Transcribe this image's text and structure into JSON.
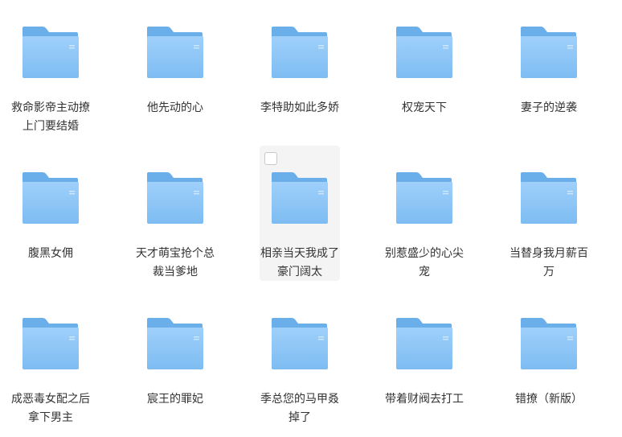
{
  "folders": [
    {
      "name": "救命影帝主动撩上门要结婚"
    },
    {
      "name": "他先动的心"
    },
    {
      "name": "李特助如此多娇"
    },
    {
      "name": "权宠天下"
    },
    {
      "name": "妻子的逆袭"
    },
    {
      "name": "腹黑女佣"
    },
    {
      "name": "天才萌宝抢个总裁当爹地"
    },
    {
      "name": "相亲当天我成了豪门阔太"
    },
    {
      "name": "别惹盛少的心尖宠"
    },
    {
      "name": "当替身我月薪百万"
    },
    {
      "name": "成恶毒女配之后拿下男主"
    },
    {
      "name": "宸王的罪妃"
    },
    {
      "name": "季总您的马甲叒掉了"
    },
    {
      "name": "带着财阀去打工"
    },
    {
      "name": "错撩（新版）"
    }
  ],
  "colors": {
    "folder_back": "#6aaeea",
    "folder_front_top": "#9fd0fa",
    "folder_front_bottom": "#7dbcf2",
    "hover_bg": "#f4f4f4",
    "text": "#333333"
  },
  "icons": {
    "folder": "folder-icon",
    "select": "checkbox-icon"
  },
  "state": {
    "hovered_index": 7
  }
}
